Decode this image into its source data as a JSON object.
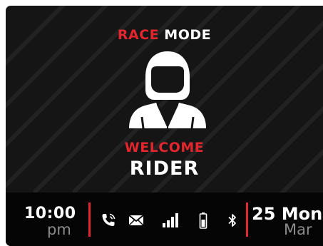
{
  "header": {
    "mode_accent": "RACE",
    "mode_label": "MODE"
  },
  "greeting": {
    "welcome": "WELCOME",
    "name": "RIDER"
  },
  "avatar": {
    "icon": "rider-helmet-icon"
  },
  "status": {
    "time": "10:00",
    "ampm": "pm",
    "icons": [
      "phone-call-icon",
      "mail-icon",
      "signal-bars-icon",
      "battery-icon",
      "bluetooth-icon"
    ],
    "date": "25 Mon",
    "month": "Mar"
  },
  "colors": {
    "accent": "#e3262d",
    "background": "#151515",
    "statusbar": "#050505",
    "muted": "#8c8c8c"
  }
}
